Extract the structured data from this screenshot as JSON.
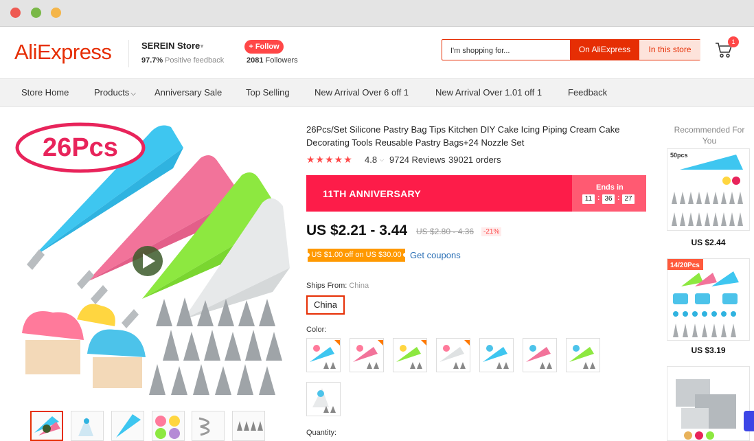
{
  "header": {
    "logo": "AliExpress",
    "store_name": "SEREIN Store",
    "feedback_pct": "97.7%",
    "feedback_label": "Positive feedback",
    "follow_label": "+ Follow",
    "followers_count": "2081",
    "followers_label": "Followers",
    "search_placeholder": "I'm shopping for...",
    "search_on_ali": "On AliExpress",
    "search_in_store": "In this store",
    "cart_count": "1"
  },
  "nav": {
    "items": [
      "Store Home",
      "Products",
      "Anniversary Sale",
      "Top Selling",
      "New Arrival Over 6 off 1",
      "New Arrival Over 1.01 off 1",
      "Feedback"
    ]
  },
  "gallery": {
    "badge_text": "26Pcs"
  },
  "product": {
    "title": "26Pcs/Set Silicone Pastry Bag Tips Kitchen DIY Cake Icing Piping Cream Cake Decorating Tools Reusable Pastry Bags+24 Nozzle Set",
    "stars": "★★★★★",
    "rating": "4.8",
    "reviews": "9724 Reviews",
    "orders": "39021 orders",
    "banner_title": "11TH ANNIVERSARY",
    "ends_in_label": "Ends in",
    "timer": [
      "11",
      "36",
      "27"
    ],
    "price": "US $2.21 - 3.44",
    "old_price": "US $2.80 - 4.36",
    "discount": "-21%",
    "coupon": "US $1.00 off on US $30.00",
    "get_coupons": "Get coupons",
    "ships_from_label": "Ships From:",
    "ships_from_value": "China",
    "ships_option": "China",
    "color_label": "Color:",
    "quantity_label": "Quantity:"
  },
  "recommended": {
    "title": "Recommended For You",
    "items": [
      {
        "tag": "50pcs",
        "price": "US $2.44"
      },
      {
        "tag": "14/20Pcs",
        "price": "US $3.19"
      },
      {
        "tag": "",
        "price": ""
      }
    ]
  },
  "colors": {
    "accent": "#e62e04",
    "banner": "#fd1c49",
    "coupon": "#ff9900",
    "link": "#2a6fb5"
  }
}
